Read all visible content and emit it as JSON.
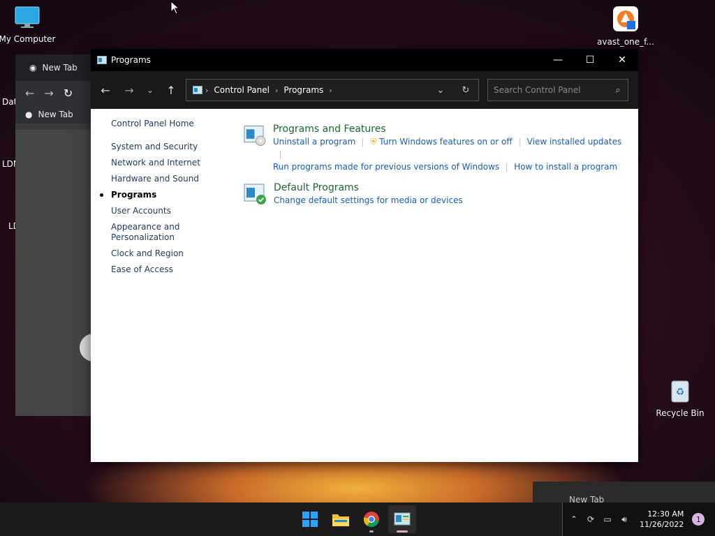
{
  "desktop": {
    "icons": [
      {
        "label": "My Computer"
      },
      {
        "label": "avast_one_f..."
      },
      {
        "label": "Recycle Bin"
      }
    ],
    "partial_labels": [
      "Dat",
      "LDM",
      "LD"
    ]
  },
  "browser": {
    "tab_label": "New Tab",
    "bookmark_label": "New Tab"
  },
  "window": {
    "title": "Programs",
    "address": {
      "segments": [
        "Control Panel",
        "Programs"
      ]
    },
    "search": {
      "placeholder": "Search Control Panel"
    }
  },
  "sidebar": {
    "home": "Control Panel Home",
    "items": [
      {
        "label": "System and Security"
      },
      {
        "label": "Network and Internet"
      },
      {
        "label": "Hardware and Sound"
      },
      {
        "label": "Programs",
        "active": true
      },
      {
        "label": "User Accounts"
      },
      {
        "label": "Appearance and Personalization"
      },
      {
        "label": "Clock and Region"
      },
      {
        "label": "Ease of Access"
      }
    ]
  },
  "categories": [
    {
      "title": "Programs and Features",
      "links": [
        "Uninstall a program",
        "Turn Windows features on or off",
        "View installed updates",
        "Run programs made for previous versions of Windows",
        "How to install a program"
      ]
    },
    {
      "title": "Default Programs",
      "links": [
        "Change default settings for media or devices"
      ]
    }
  ],
  "taskbar": {
    "peek_label": "New Tab",
    "time": "12:30 AM",
    "date": "11/26/2022",
    "notifications": "1"
  },
  "colors": {
    "link": "#1a5fb4",
    "category_title": "#1a6b2c",
    "titlebar": "#000000"
  }
}
